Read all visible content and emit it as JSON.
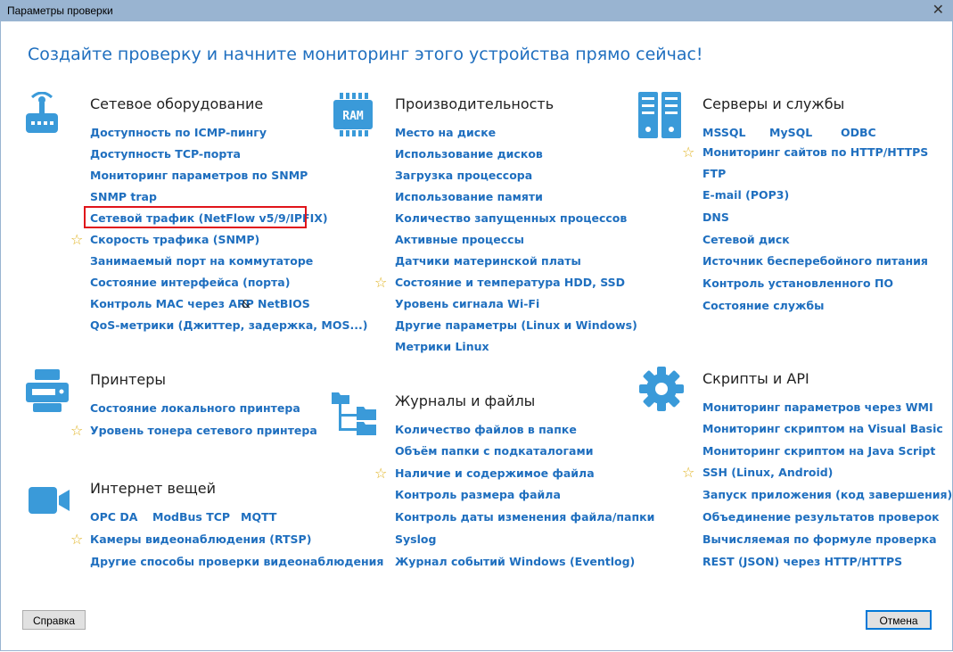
{
  "window": {
    "title": "Параметры проверки"
  },
  "headline": "Создайте проверку и начните мониторинг этого устройства прямо сейчас!",
  "network": {
    "title": "Сетевое оборудование",
    "items": [
      "Доступность по ICMP-пингу",
      "Доступность TCP-порта",
      "Мониторинг параметров по SNMP",
      "SNMP trap",
      "Сетевой трафик (NetFlow v5/9/IPFIX)",
      "Скорость трафика (SNMP)",
      "Занимаемый порт на коммутаторе",
      "Состояние интерфейса (порта)",
      "Контроль MAC через ARP",
      "NetBIOS",
      "QoS-метрики (Джиттер, задержка, MOS...)"
    ],
    "amp": "&"
  },
  "performance": {
    "title": "Производительность",
    "items": [
      "Место на диске",
      "Использование дисков",
      "Загрузка процессора",
      "Использование памяти",
      "Количество запущенных процессов",
      "Активные процессы",
      "Датчики материнской платы",
      "Состояние и температура HDD, SSD",
      "Уровень сигнала Wi-Fi",
      "Другие параметры (Linux и Windows)",
      "Метрики Linux"
    ]
  },
  "servers": {
    "title": "Серверы и службы",
    "items": [
      "MSSQL",
      "MySQL",
      "ODBC",
      "Мониторинг сайтов по HTTP/HTTPS",
      "FTP",
      "E-mail (POP3)",
      "DNS",
      "Сетевой диск",
      "Источник бесперебойного питания",
      "Контроль установленного ПО",
      "Состояние службы"
    ]
  },
  "printers": {
    "title": "Принтеры",
    "items": [
      "Состояние локального принтера",
      "Уровень тонера сетевого принтера"
    ]
  },
  "logs": {
    "title": "Журналы и файлы",
    "items": [
      "Количество файлов в папке",
      "Объём папки с подкаталогами",
      "Наличие и содержимое файла",
      "Контроль размера файла",
      "Контроль даты изменения файла/папки",
      "Syslog",
      "Журнал событий Windows (Eventlog)"
    ]
  },
  "scripts": {
    "title": "Скрипты и API",
    "items": [
      "Мониторинг параметров через WMI",
      "Мониторинг скриптом на Visual Basic",
      "Мониторинг скриптом на Java Script",
      "SSH (Linux, Android)",
      "Запуск приложения (код завершения)",
      "Объединение результатов проверок",
      "Вычисляемая по формуле проверка",
      "REST (JSON) через HTTP/HTTPS"
    ]
  },
  "iot": {
    "title": "Интернет вещей",
    "items": [
      "OPC DA",
      "ModBus TCP",
      "MQTT",
      "Камеры видеонаблюдения (RTSP)",
      "Другие способы проверки видеонаблюдения"
    ]
  },
  "ram_label": "RAM",
  "buttons": {
    "help": "Справка",
    "cancel": "Отмена"
  },
  "icons": {
    "network": "router-icon",
    "performance": "ram-icon",
    "servers": "server-icon",
    "printers": "printer-icon",
    "logs": "folder-tree-icon",
    "scripts": "gear-icon",
    "iot": "video-camera-icon",
    "favorite": "star-icon"
  },
  "colors": {
    "accent": "#1f6fbf",
    "icon": "#3a9ad9",
    "star": "#e0b21f",
    "highlight": "#e0141a"
  }
}
